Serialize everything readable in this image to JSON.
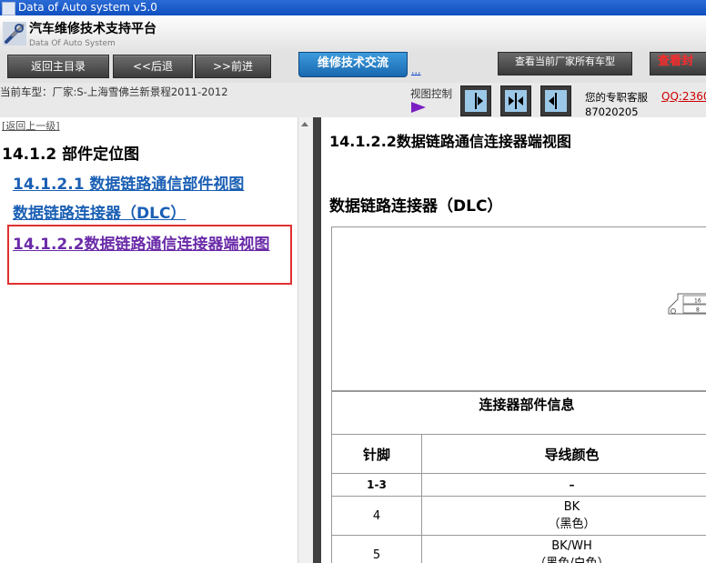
{
  "window": {
    "title": "Data of Auto system v5.0"
  },
  "header": {
    "app_title": "汽车维修技术支持平台",
    "app_subtitle": "Data Of Auto System"
  },
  "toolbar": {
    "home_label": "返回主目录",
    "back_label": "<<后退",
    "forward_label": ">>前进",
    "forum_label": "维修技术交流",
    "forum_link": "...",
    "view_all_label": "查看当前厂家所有车型",
    "search_label": "查看封"
  },
  "infobar": {
    "current_model": "当前车型：厂家:S-上海雪佛兰新景程2011-2012",
    "view_control_label": "视图控制",
    "support_label": "您的专职客服",
    "qq_label": "QQ:2360",
    "qq_number": "87020205"
  },
  "left": {
    "back_up": "[返回上一级]",
    "section_title": "14.1.2 部件定位图",
    "links": [
      "14.1.2.1 数据链路通信部件视图",
      "数据链路连接器（DLC）",
      "14.1.2.2数据链路通信连接器端视图"
    ]
  },
  "right": {
    "doc_title": "14.1.2.2数据链路通信连接器端视图",
    "dlc_heading": "数据链路连接器（DLC）",
    "connector_pins": [
      "16",
      "8"
    ],
    "table": {
      "caption": "连接器部件信息",
      "headers": [
        "针脚",
        "导线颜色"
      ],
      "rows": [
        {
          "pin": "1-3",
          "color": "–",
          "color_cn": ""
        },
        {
          "pin": "4",
          "color": "BK",
          "color_cn": "（黑色）"
        },
        {
          "pin": "5",
          "color": "BK/WH",
          "color_cn": "（黑色/白色）"
        }
      ]
    }
  }
}
